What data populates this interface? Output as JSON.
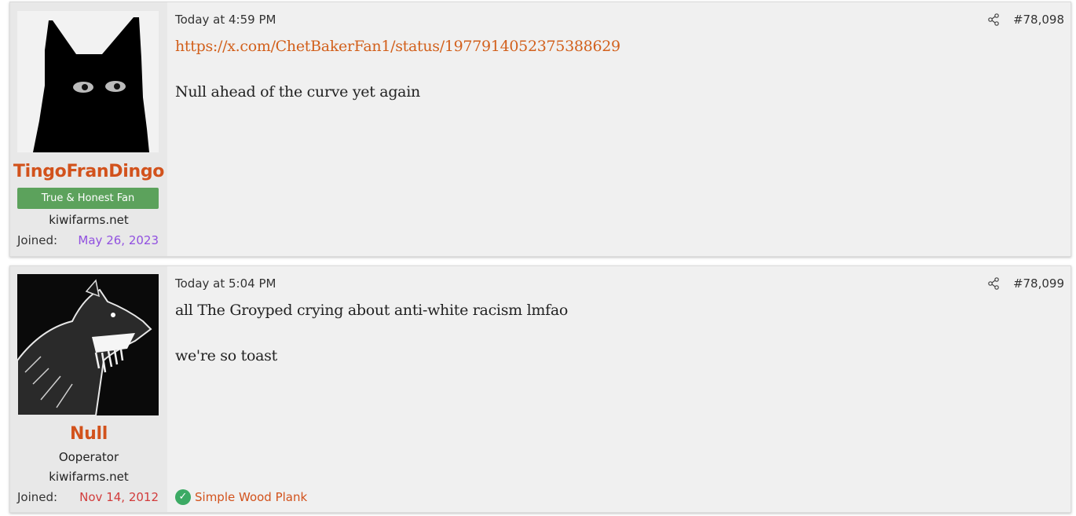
{
  "posts": [
    {
      "username": "TingoFranDingo",
      "banner": "True & Honest Fan",
      "site": "kiwifarms.net",
      "joined_label": "Joined:",
      "joined_date": "May 26, 2023",
      "timestamp": "Today at 4:59 PM",
      "post_number": "#78,098",
      "link": "https://x.com/ChetBakerFan1/status/1977914052375388629",
      "text": "Null ahead of the curve yet again"
    },
    {
      "username": "Null",
      "user_title": "Ooperator",
      "site": "kiwifarms.net",
      "joined_label": "Joined:",
      "joined_date": "Nov 14, 2012",
      "timestamp": "Today at 5:04 PM",
      "post_number": "#78,099",
      "text_line1": "all The Groyped crying about anti-white racism lmfao",
      "text_line2": "we're so toast",
      "reaction_label": "Simple Wood Plank"
    }
  ],
  "icons": {
    "share": "share-icon",
    "reaction": "check-circle-icon"
  },
  "colors": {
    "username": "#d2521c",
    "link": "#d2601c",
    "banner": "#5ca25c",
    "joined_purple": "#9150e0",
    "joined_red": "#d23c3c",
    "reaction": "#3caa64"
  }
}
